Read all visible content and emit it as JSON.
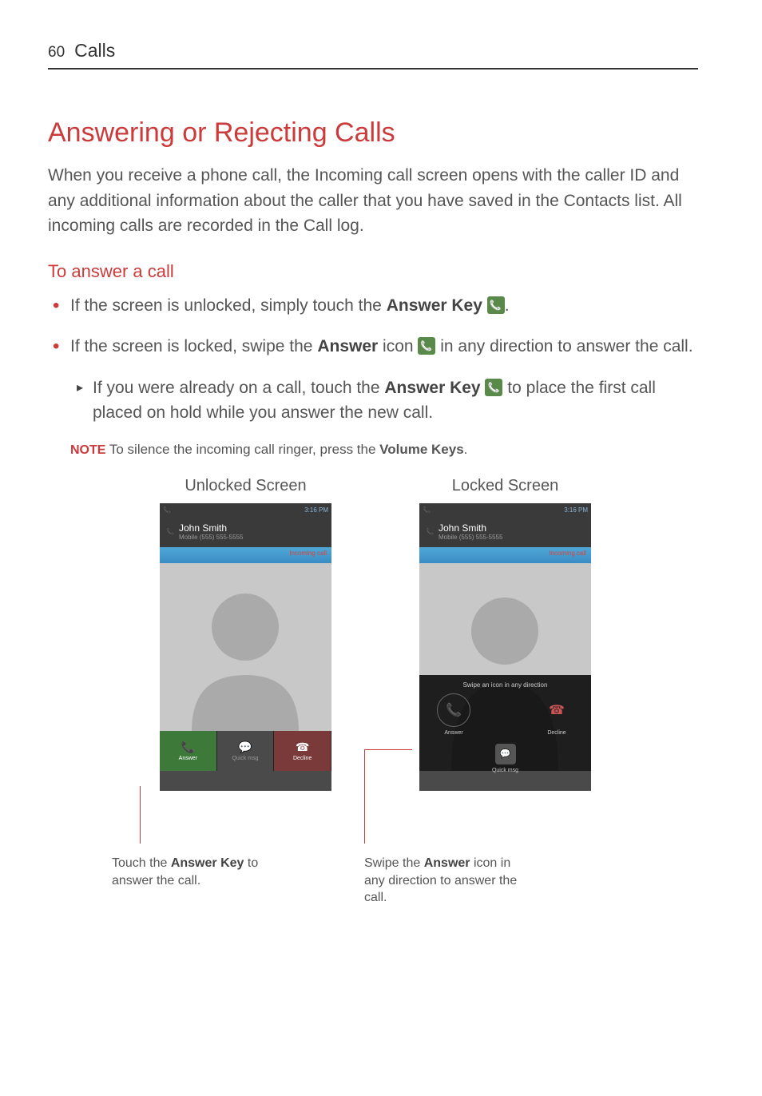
{
  "header": {
    "page_number": "60",
    "section": "Calls"
  },
  "title": "Answering or Rejecting Calls",
  "intro": "When you receive a phone call, the Incoming call screen opens with the caller ID and any additional information about the caller that you have saved in the Contacts list. All incoming calls are recorded in the Call log.",
  "subheading": "To answer a call",
  "bullets": {
    "b1_pre": "If the screen is unlocked, simply touch the ",
    "b1_bold": "Answer Key",
    "b1_post": ".",
    "b2_pre": "If the screen is locked, swipe the ",
    "b2_bold": "Answer",
    "b2_mid": " icon ",
    "b2_post": " in any direction to answer the call.",
    "sub_pre": "If you were already on a call, touch the ",
    "sub_bold": "Answer Key",
    "sub_post": " to place the first call placed on hold while you answer the new call."
  },
  "note": {
    "label": "NOTE",
    "pre": " To silence the incoming call ringer, press the ",
    "bold": "Volume Keys",
    "post": "."
  },
  "screens": {
    "unlocked_label": "Unlocked Screen",
    "locked_label": "Locked Screen",
    "status_time": "3:16 PM",
    "caller_name": "John Smith",
    "caller_number_unlocked": "Mobile (555) 555-5555",
    "caller_number_locked": "Mobile (555) 555-5555",
    "incoming_label": "Incoming call",
    "swipe_hint": "Swipe an icon in any direction",
    "buttons": {
      "answer": "Answer",
      "quickmsg": "Quick msg",
      "decline": "Decline"
    }
  },
  "captions": {
    "unlocked_pre": "Touch the ",
    "unlocked_bold": "Answer Key",
    "unlocked_post": " to answer the call.",
    "locked_pre": "Swipe the ",
    "locked_bold": "Answer",
    "locked_post": " icon in any direction to answer the call."
  }
}
